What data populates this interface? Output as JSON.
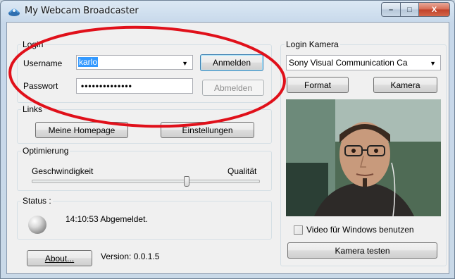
{
  "window": {
    "title": "My Webcam Broadcaster",
    "caption_buttons": [
      "–",
      "□",
      "X"
    ]
  },
  "login": {
    "legend": "Login",
    "username_label": "Username",
    "username_value": "karlo",
    "password_label": "Passwort",
    "password_value": "••••••••••••••",
    "login_button": "Anmelden",
    "logout_button": "Abmelden"
  },
  "links": {
    "legend": "Links",
    "homepage_button": "Meine Homepage",
    "settings_button": "Einstellungen"
  },
  "optimize": {
    "legend": "Optimierung",
    "left_label": "Geschwindigkeit",
    "right_label": "Qualität",
    "slider_position": 0.68
  },
  "status": {
    "legend": "Status :",
    "text": "14:10:53 Abgemeldet."
  },
  "footer": {
    "about_button": "About...",
    "version": "Version: 0.0.1.5"
  },
  "camera": {
    "legend": "Login Kamera",
    "device": "Sony Visual Communication Ca",
    "format_button": "Format",
    "camera_button": "Kamera",
    "vfw_label": "Video für Windows benutzen",
    "test_button": "Kamera testen"
  },
  "colors": {
    "annotation_red": "#e0101a",
    "selection_blue": "#3399ff"
  }
}
